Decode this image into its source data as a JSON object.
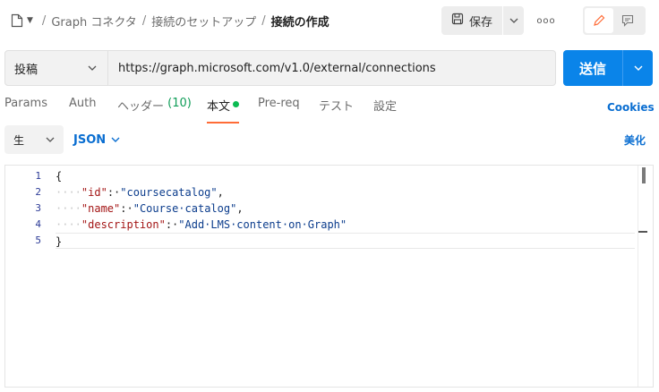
{
  "breadcrumb": {
    "items": [
      "Graph コネクタ",
      "接続のセットアップ"
    ],
    "current": "接続の作成",
    "separator": "/"
  },
  "toolbar": {
    "save_label": "保存",
    "more_label": "ooo"
  },
  "request": {
    "method": "投稿",
    "url": "https://graph.microsoft.com/v1.0/external/connections",
    "send_label": "送信"
  },
  "tabs": [
    {
      "label": "Params"
    },
    {
      "label": "Auth"
    },
    {
      "label": "ヘッダー",
      "count": "(10)"
    },
    {
      "label": "本文",
      "active": true
    },
    {
      "label": "Pre-req"
    },
    {
      "label": "テスト"
    },
    {
      "label": "設定"
    }
  ],
  "cookies_label": "Cookies",
  "body": {
    "mode": "生",
    "format": "JSON",
    "beautify_label": "美化"
  },
  "editor": {
    "line_numbers": [
      "1",
      "2",
      "3",
      "4",
      "5"
    ],
    "lines": [
      {
        "ws": "",
        "key": "",
        "sep": "",
        "value": "",
        "text": "{"
      },
      {
        "ws": "····",
        "key": "\"id\"",
        "sep": ":·",
        "value": "\"coursecatalog\"",
        "text": ","
      },
      {
        "ws": "····",
        "key": "\"name\"",
        "sep": ":·",
        "value": "\"Course·catalog\"",
        "text": ","
      },
      {
        "ws": "····",
        "key": "\"description\"",
        "sep": ":·",
        "value": "\"Add·LMS·content·on·Graph\"",
        "text": ""
      },
      {
        "ws": "",
        "key": "",
        "sep": "",
        "value": "",
        "text": "}"
      }
    ]
  },
  "colors": {
    "accent": "#0a84e9",
    "link": "#0a6ed1",
    "active_tab_underline": "#ff6c37",
    "status_dot": "#0cbb52"
  }
}
